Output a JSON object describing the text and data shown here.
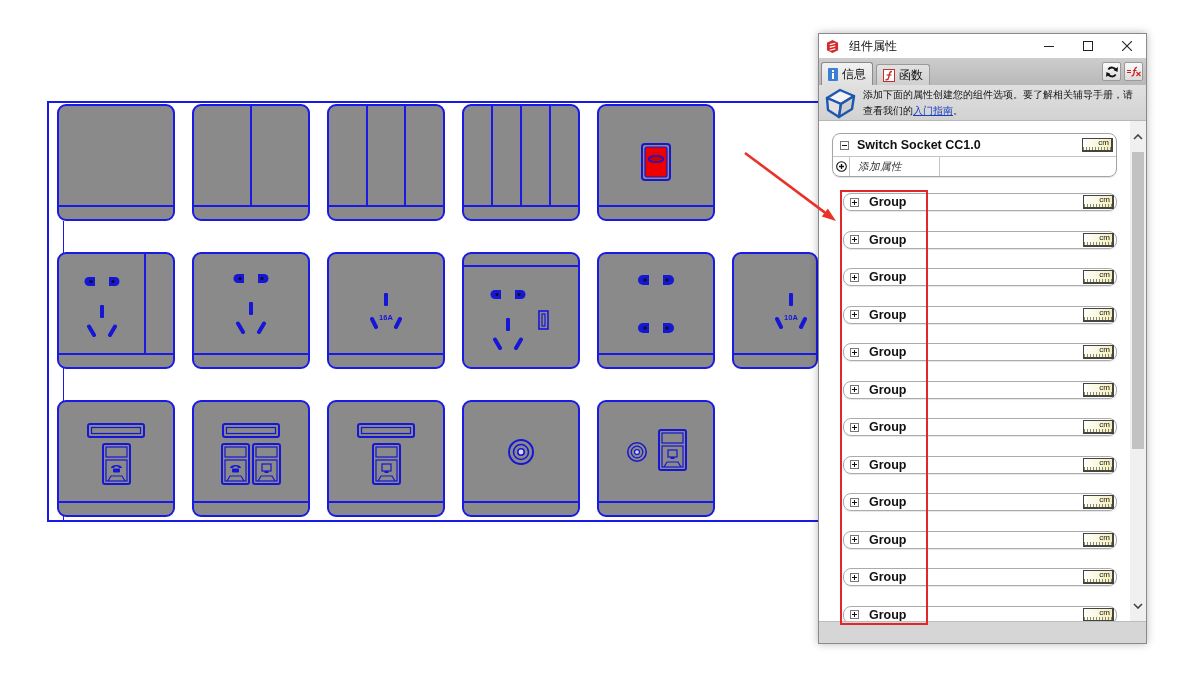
{
  "scene": {
    "rows": [
      {
        "tiles": [
          {
            "kind": "gang1"
          },
          {
            "kind": "gang2"
          },
          {
            "kind": "gang3"
          },
          {
            "kind": "gang4"
          },
          {
            "kind": "lamp"
          }
        ]
      },
      {
        "tiles": [
          {
            "kind": "switched"
          },
          {
            "kind": "fivehole"
          },
          {
            "kind": "threepin",
            "rating": "16A"
          },
          {
            "kind": "usb"
          },
          {
            "kind": "twopin"
          },
          {
            "kind": "threepin",
            "rating": "10A"
          }
        ]
      },
      {
        "tiles": [
          {
            "kind": "phone"
          },
          {
            "kind": "phonedata"
          },
          {
            "kind": "data"
          },
          {
            "kind": "tv"
          },
          {
            "kind": "tvdata"
          }
        ]
      }
    ]
  },
  "panel": {
    "title": "组件属性",
    "tabs": [
      {
        "label": "信息",
        "kind": "info",
        "selected": true
      },
      {
        "label": "函数",
        "kind": "function",
        "selected": false
      }
    ],
    "info": {
      "text": "添加下面的属性创建您的组件选项。要了解相关辅导手册，请查看我们的",
      "link": "入门指南",
      "text_end": "。"
    },
    "component": {
      "name": "Switch Socket CC1.0",
      "unit": "cm",
      "expanded": true,
      "add_label": "添加属性"
    },
    "groups": [
      {
        "name": "Group",
        "unit": "cm",
        "expanded": false
      },
      {
        "name": "Group",
        "unit": "cm",
        "expanded": false
      },
      {
        "name": "Group",
        "unit": "cm",
        "expanded": false
      },
      {
        "name": "Group",
        "unit": "cm",
        "expanded": false
      },
      {
        "name": "Group",
        "unit": "cm",
        "expanded": false
      },
      {
        "name": "Group",
        "unit": "cm",
        "expanded": false
      },
      {
        "name": "Group",
        "unit": "cm",
        "expanded": false
      },
      {
        "name": "Group",
        "unit": "cm",
        "expanded": false
      },
      {
        "name": "Group",
        "unit": "cm",
        "expanded": false
      },
      {
        "name": "Group",
        "unit": "cm",
        "expanded": false
      },
      {
        "name": "Group",
        "unit": "cm",
        "expanded": false
      },
      {
        "name": "Group",
        "unit": "cm",
        "expanded": false
      }
    ]
  }
}
